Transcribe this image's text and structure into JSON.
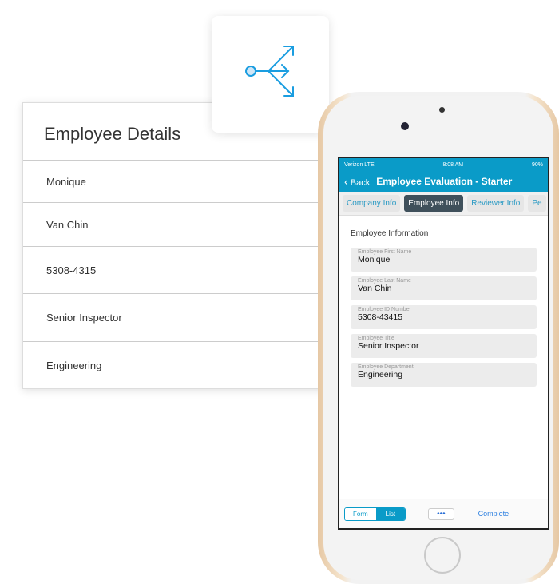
{
  "details_card": {
    "title": "Employee Details",
    "rows": [
      "Monique",
      "Van Chin",
      "5308-4315",
      "Senior Inspector",
      "Engineering"
    ]
  },
  "icon_card": {
    "icon": "branch-arrows-icon",
    "color": "#1a9de0"
  },
  "phone": {
    "status": {
      "carrier": "Verizon  LTE",
      "time": "8:08 AM",
      "battery": "90%"
    },
    "nav": {
      "back": "Back",
      "title": "Employee Evaluation - Starter"
    },
    "tabs": [
      {
        "label": "Company Info"
      },
      {
        "label": "Employee Info",
        "active": true
      },
      {
        "label": "Reviewer Info"
      },
      {
        "label": "Pe"
      }
    ],
    "section_title": "Employee Information",
    "fields": [
      {
        "label": "Employee First Name",
        "value": "Monique"
      },
      {
        "label": "Employee Last Name",
        "value": "Van Chin"
      },
      {
        "label": "Employee ID Number",
        "value": "5308-43415"
      },
      {
        "label": "Employee Title",
        "value": "Senior Inspector"
      },
      {
        "label": "Employee Department",
        "value": "Engineering"
      }
    ],
    "toolbar": {
      "form": "Form",
      "list": "List",
      "more": "•••",
      "complete": "Complete"
    },
    "accent": "#0a9bc8"
  }
}
